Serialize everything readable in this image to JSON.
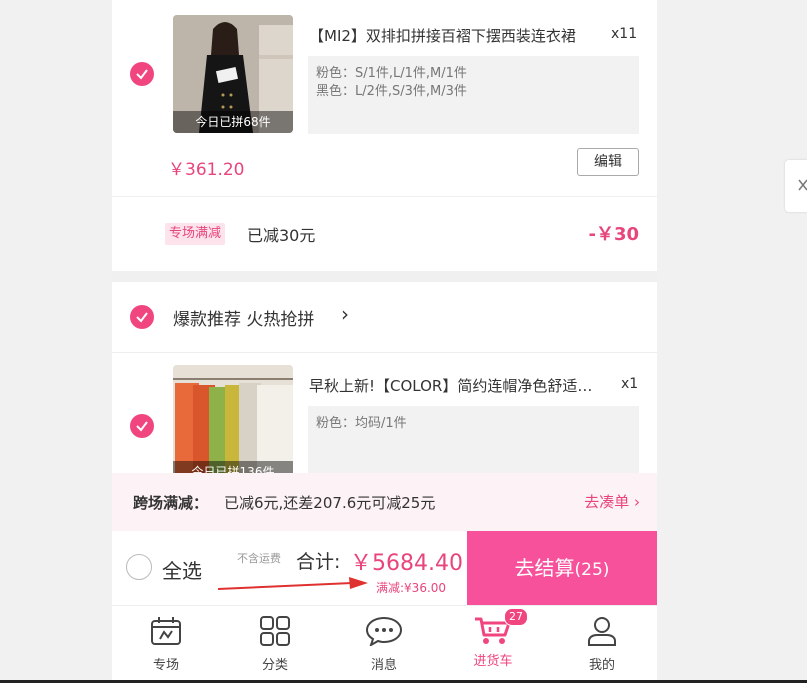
{
  "product1": {
    "title": "【MI2】双排扣拼接百褶下摆西装连衣裙",
    "qty": "x11",
    "spec_line1": "粉色：S/1件,L/1件,M/1件",
    "spec_line2": "黑色：L/2件,S/3件,M/3件",
    "badge": "今日已拼68件",
    "price": "￥361.20",
    "edit_label": "编辑"
  },
  "promo": {
    "tag": "专场满减",
    "text": "已减30元",
    "amount": "-￥30"
  },
  "section2": {
    "title": "爆款推荐 火热抢拼",
    "chevron": "›"
  },
  "product2": {
    "title": "早秋上新!【COLOR】简约连帽净色舒适卫衣",
    "qty": "x1",
    "spec_line1": "粉色：均码/1件",
    "badge": "今日已拼136件"
  },
  "cross_promo": {
    "label": "跨场满减：",
    "text": "已减6元,还差207.6元可减25元",
    "link": "去凑单",
    "chevron": "›"
  },
  "checkout": {
    "select_all": "全选",
    "shipping_note": "不含运费",
    "total_label": "合计:",
    "total_value": "￥5684.40",
    "discount_note": "满减:¥36.00",
    "button_label": "去结算",
    "button_count": "(25)"
  },
  "tabs": [
    {
      "label": "专场",
      "icon": "calendar-icon"
    },
    {
      "label": "分类",
      "icon": "grid-icon"
    },
    {
      "label": "消息",
      "icon": "chat-icon"
    },
    {
      "label": "进货车",
      "icon": "cart-icon",
      "badge": "27",
      "active": true
    },
    {
      "label": "我的",
      "icon": "user-icon"
    }
  ],
  "colors": {
    "accent": "#e8457d",
    "checkout_button": "#f6519a",
    "tag_bg": "#fde3ec",
    "annotation_arrow": "#e03131"
  }
}
